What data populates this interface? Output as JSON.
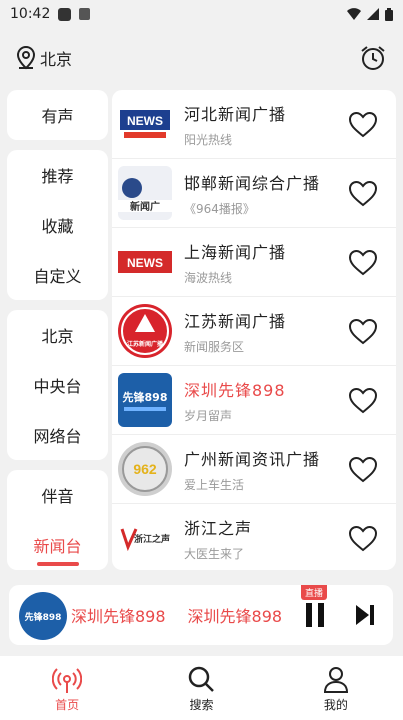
{
  "status_bar": {
    "time": "10:42"
  },
  "header": {
    "city": "北京",
    "icon_location": "location-pin-icon",
    "icon_alarm": "alarm-clock-icon"
  },
  "sidebar": {
    "group1": [
      "有声"
    ],
    "group2": [
      "推荐",
      "收藏",
      "自定义"
    ],
    "group3": [
      "北京",
      "中央台",
      "网络台"
    ],
    "group4": [
      "伴音",
      "新闻台"
    ],
    "active": "新闻台"
  },
  "stations": [
    {
      "title": "河北新闻广播",
      "subtitle": "阳光热线",
      "logo": "NEWS",
      "active": false
    },
    {
      "title": "邯郸新闻综合广播",
      "subtitle": "《964播报》",
      "logo": "新闻广",
      "active": false
    },
    {
      "title": "上海新闻广播",
      "subtitle": "海波热线",
      "logo": "NEWS",
      "active": false
    },
    {
      "title": "江苏新闻广播",
      "subtitle": "新闻服务区",
      "logo": "江苏新闻广播",
      "active": false
    },
    {
      "title": "深圳先锋898",
      "subtitle": "岁月留声",
      "logo": "先锋898",
      "active": true
    },
    {
      "title": "广州新闻资讯广播",
      "subtitle": "爱上车生活",
      "logo": "962",
      "active": false
    },
    {
      "title": "浙江之声",
      "subtitle": "大医生来了",
      "logo": "浙江之声",
      "active": false
    }
  ],
  "player": {
    "now_playing": "深圳先锋898",
    "now_playing_repeat": "深圳先锋898",
    "live_badge": "直播",
    "logo": "先锋898"
  },
  "bottom_nav": [
    {
      "label": "首页",
      "icon": "radio-waves-icon",
      "active": true
    },
    {
      "label": "搜索",
      "icon": "search-icon",
      "active": false
    },
    {
      "label": "我的",
      "icon": "user-icon",
      "active": false
    }
  ],
  "colors": {
    "accent": "#e94a4a",
    "background": "#f1f1f1"
  }
}
